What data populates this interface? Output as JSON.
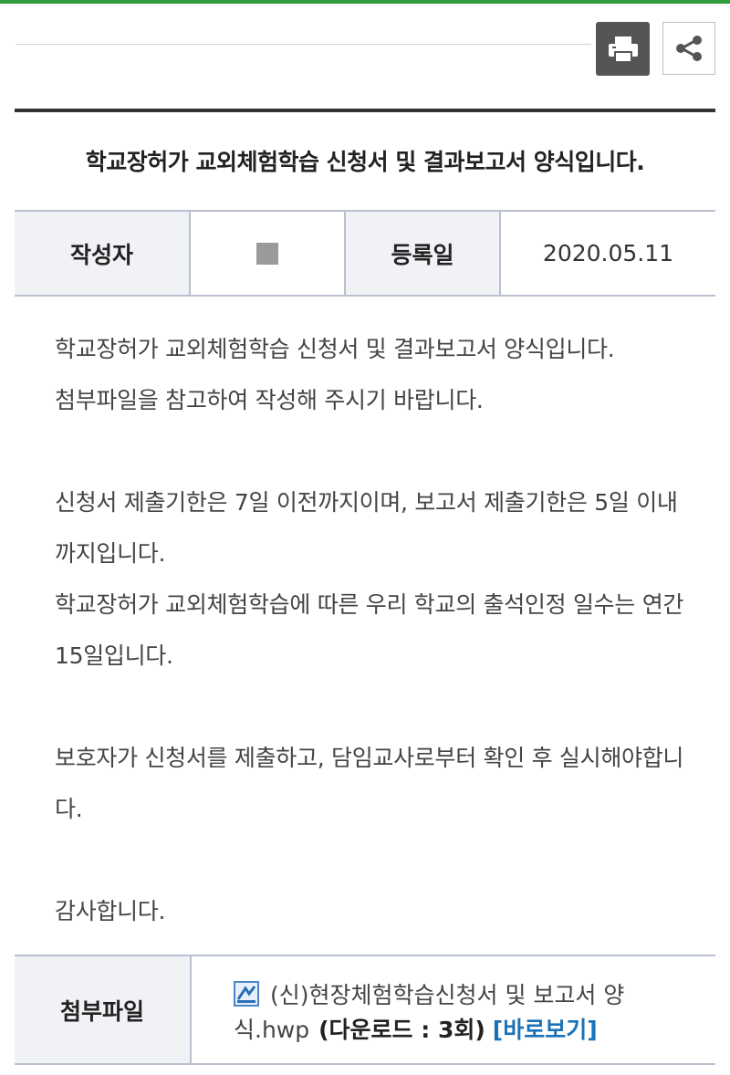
{
  "toolbar": {
    "print_icon": "printer-icon",
    "share_icon": "share-icon"
  },
  "post": {
    "title": "학교장허가 교외체험학습 신청서 및 결과보고서 양식입니다.",
    "meta": {
      "author_label": "작성자",
      "date_label": "등록일",
      "date_value": "2020.05.11"
    },
    "body": [
      "학교장허가 교외체험학습 신청서 및 결과보고서 양식입니다.",
      "첨부파일을 참고하여 작성해 주시기 바랍니다.",
      "",
      "신청서 제출기한은 7일 이전까지이며, 보고서 제출기한은 5일 이내까지입니다.",
      "학교장허가 교외체험학습에 따른 우리 학교의 출석인정 일수는 연간 15일입니다.",
      "",
      "보호자가 신청서를 제출하고, 담임교사로부터 확인 후 실시해야합니다.",
      "",
      "감사합니다."
    ],
    "attachment": {
      "label": "첨부파일",
      "file_name": "(신)현장체험학습신청서 및 보고서 양식.hwp",
      "download_count": "(다운로드 : 3회)",
      "preview_link": "[바로보기]",
      "file_icon": "hwp-file-icon"
    }
  },
  "colors": {
    "accent_green": "#2e9b3c",
    "link_blue": "#1a73b8",
    "table_border": "#b9c0cf",
    "label_bg": "#f1f2f6"
  }
}
